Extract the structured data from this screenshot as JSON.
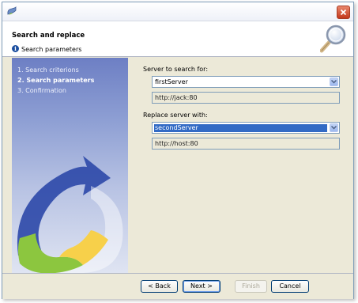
{
  "header": {
    "title": "Search and replace",
    "subtitle": "Search parameters"
  },
  "steps": [
    {
      "label": "1. Search criterions",
      "active": false
    },
    {
      "label": "2. Search parameters",
      "active": true
    },
    {
      "label": "3. Confirmation",
      "active": false
    }
  ],
  "search": {
    "label": "Server to search for:",
    "selected": "firstServer",
    "address": "http://jack:80"
  },
  "replace": {
    "label": "Replace server with:",
    "selected": "secondServer",
    "address": "http://host:80"
  },
  "buttons": {
    "back": "< Back",
    "next": "Next >",
    "finish": "Finish",
    "cancel": "Cancel"
  },
  "colors": {
    "selection": "#316ac5",
    "sidebar_top": "#6d7fc4",
    "close_button": "#c3381c"
  },
  "icons": [
    "app-icon",
    "close-icon",
    "info-icon",
    "magnifier-icon",
    "chevron-down-icon"
  ]
}
